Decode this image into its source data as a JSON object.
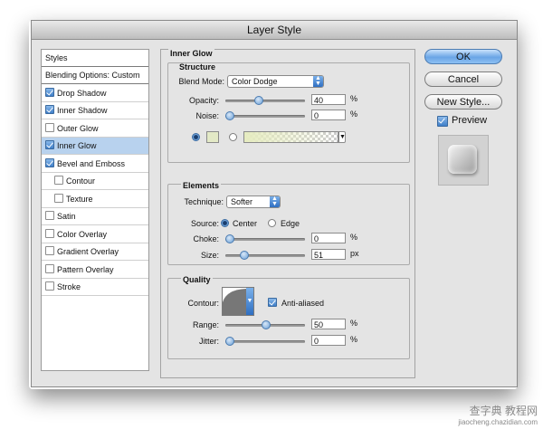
{
  "window": {
    "title": "Layer Style"
  },
  "styles_list": {
    "header": "Styles",
    "items": [
      {
        "label": "Blending Options: Custom",
        "checkbox": false,
        "checked": false,
        "selected": false,
        "sub": false
      },
      {
        "label": "Drop Shadow",
        "checkbox": true,
        "checked": true,
        "selected": false,
        "sub": false
      },
      {
        "label": "Inner Shadow",
        "checkbox": true,
        "checked": true,
        "selected": false,
        "sub": false
      },
      {
        "label": "Outer Glow",
        "checkbox": true,
        "checked": false,
        "selected": false,
        "sub": false
      },
      {
        "label": "Inner Glow",
        "checkbox": true,
        "checked": true,
        "selected": true,
        "sub": false
      },
      {
        "label": "Bevel and Emboss",
        "checkbox": true,
        "checked": true,
        "selected": false,
        "sub": false
      },
      {
        "label": "Contour",
        "checkbox": true,
        "checked": false,
        "selected": false,
        "sub": true
      },
      {
        "label": "Texture",
        "checkbox": true,
        "checked": false,
        "selected": false,
        "sub": true
      },
      {
        "label": "Satin",
        "checkbox": true,
        "checked": false,
        "selected": false,
        "sub": false
      },
      {
        "label": "Color Overlay",
        "checkbox": true,
        "checked": false,
        "selected": false,
        "sub": false
      },
      {
        "label": "Gradient Overlay",
        "checkbox": true,
        "checked": false,
        "selected": false,
        "sub": false
      },
      {
        "label": "Pattern Overlay",
        "checkbox": true,
        "checked": false,
        "selected": false,
        "sub": false
      },
      {
        "label": "Stroke",
        "checkbox": true,
        "checked": false,
        "selected": false,
        "sub": false
      }
    ]
  },
  "inner_glow": {
    "title": "Inner Glow",
    "structure": {
      "title": "Structure",
      "blend_mode_label": "Blend Mode:",
      "blend_mode": "Color Dodge",
      "opacity_label": "Opacity:",
      "opacity": "40",
      "opacity_level": 0.4,
      "opacity_unit": "%",
      "noise_label": "Noise:",
      "noise": "0",
      "noise_level": 0,
      "noise_unit": "%",
      "color_swatch": "#e3e9c6",
      "gradient_from": "#e6ecc0"
    },
    "elements": {
      "title": "Elements",
      "technique_label": "Technique:",
      "technique": "Softer",
      "source_label": "Source:",
      "center_label": "Center",
      "edge_label": "Edge",
      "choke_label": "Choke:",
      "choke": "0",
      "choke_level": 0,
      "choke_unit": "%",
      "size_label": "Size:",
      "size": "51",
      "size_level": 0.2,
      "size_unit": "px"
    },
    "quality": {
      "title": "Quality",
      "contour_label": "Contour:",
      "antialiased_label": "Anti-aliased",
      "range_label": "Range:",
      "range": "50",
      "range_level": 0.5,
      "range_unit": "%",
      "jitter_label": "Jitter:",
      "jitter": "0",
      "jitter_level": 0,
      "jitter_unit": "%"
    }
  },
  "buttons": {
    "ok": "OK",
    "cancel": "Cancel",
    "new_style": "New Style...",
    "preview": "Preview"
  },
  "watermark": {
    "line1": "查字典 教程网",
    "line2": "jiaocheng.chazidian.com"
  }
}
